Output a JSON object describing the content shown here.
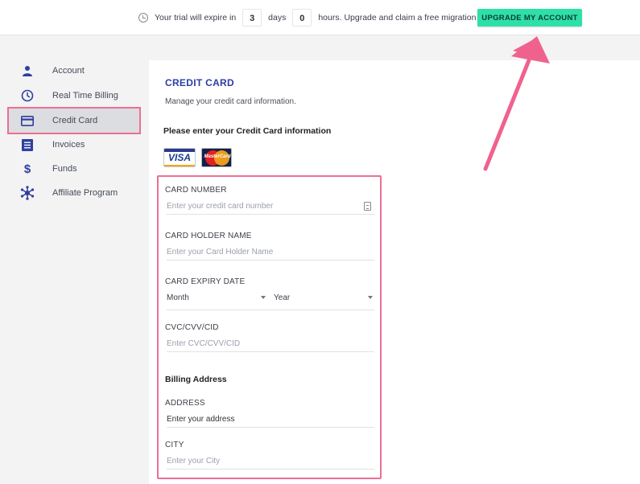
{
  "trial_bar": {
    "prefix": "Your trial will expire in",
    "days_value": "3",
    "days_label": "days",
    "hours_value": "0",
    "suffix": "hours. Upgrade and claim a free migration",
    "upgrade_label": "UPGRADE MY ACCOUNT"
  },
  "sidebar": {
    "items": [
      {
        "label": "Account",
        "icon": "person-icon"
      },
      {
        "label": "Real Time Billing",
        "icon": "clock-icon"
      },
      {
        "label": "Credit Card",
        "icon": "credit-card-icon",
        "active": true
      },
      {
        "label": "Invoices",
        "icon": "document-icon"
      },
      {
        "label": "Funds",
        "icon": "dollar-icon"
      },
      {
        "label": "Affiliate Program",
        "icon": "network-icon"
      }
    ]
  },
  "main": {
    "title": "CREDIT CARD",
    "subtitle": "Manage your credit card information.",
    "prompt": "Please enter your Credit Card information",
    "card_logos": {
      "visa": "VISA",
      "mastercard": "MasterCard"
    }
  },
  "form": {
    "card_number": {
      "label": "CARD NUMBER",
      "placeholder": "Enter your credit card number"
    },
    "holder_name": {
      "label": "CARD HOLDER NAME",
      "placeholder": "Enter your Card Holder Name"
    },
    "expiry": {
      "label": "CARD EXPIRY DATE",
      "month": "Month",
      "year": "Year"
    },
    "cvc": {
      "label": "CVC/CVV/CID",
      "placeholder": "Enter CVC/CVV/CID"
    },
    "billing_title": "Billing Address",
    "address": {
      "label": "ADDRESS",
      "value": "Enter your address"
    },
    "city": {
      "label": "CITY",
      "placeholder": "Enter your City"
    }
  },
  "colors": {
    "accent": "#2b3ea5",
    "upgrade": "#2ee0a8",
    "highlight": "#ec6f93",
    "arrow": "#f0628e"
  }
}
